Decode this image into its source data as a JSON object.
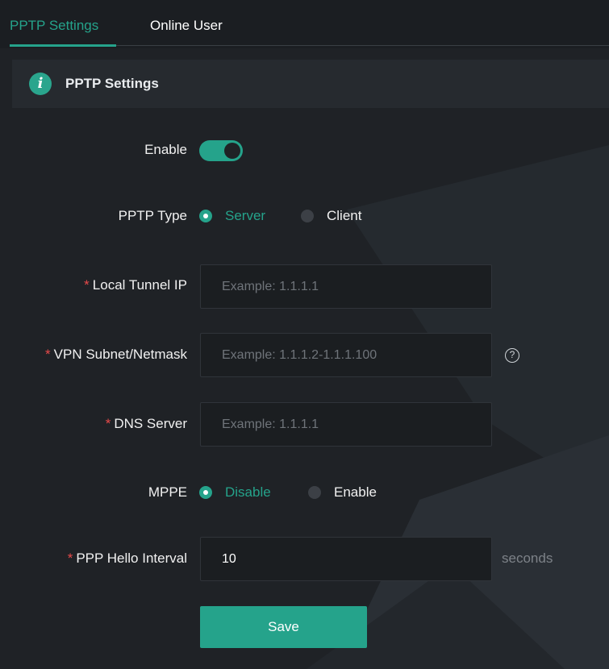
{
  "tabs": [
    {
      "label": "PPTP Settings",
      "active": true
    },
    {
      "label": "Online User",
      "active": false
    }
  ],
  "section": {
    "icon": "info-icon",
    "title": "PPTP Settings"
  },
  "form": {
    "enable": {
      "label": "Enable",
      "value": true
    },
    "pptp_type": {
      "label": "PPTP Type",
      "options": [
        "Server",
        "Client"
      ],
      "selected": "Server"
    },
    "local_tunnel_ip": {
      "label": "Local Tunnel IP",
      "required": true,
      "value": "",
      "placeholder": "Example: 1.1.1.1"
    },
    "vpn_subnet": {
      "label": "VPN Subnet/Netmask",
      "required": true,
      "value": "",
      "placeholder": "Example: 1.1.1.2-1.1.1.100",
      "help_icon": "question-circle-icon"
    },
    "dns_server": {
      "label": "DNS Server",
      "required": true,
      "value": "",
      "placeholder": "Example: 1.1.1.1"
    },
    "mppe": {
      "label": "MPPE",
      "options": [
        "Disable",
        "Enable"
      ],
      "selected": "Disable"
    },
    "ppp_hello_interval": {
      "label": "PPP Hello Interval",
      "required": true,
      "value": "10",
      "unit": "seconds"
    },
    "required_marker": "*",
    "save_label": "Save"
  },
  "colors": {
    "accent": "#25a38b",
    "background": "#1f2226",
    "required": "#e84a4a"
  }
}
